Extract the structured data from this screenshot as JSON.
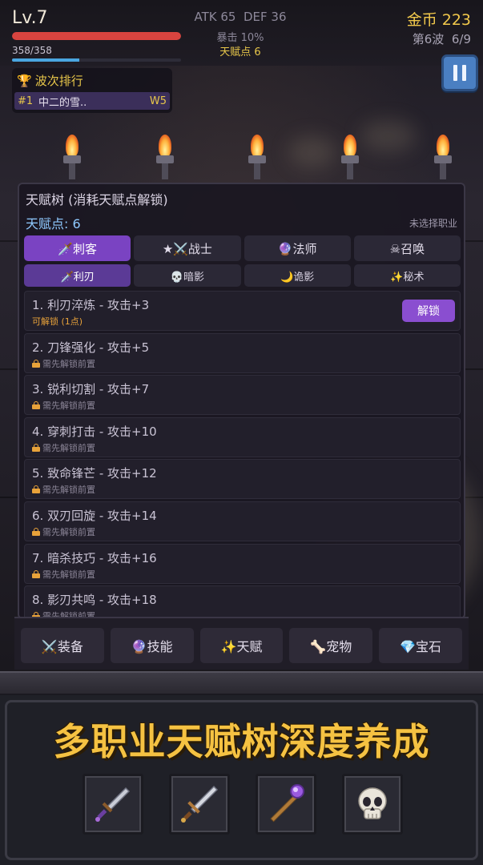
{
  "hud": {
    "level": "Lv.7",
    "hp_text": "358/358",
    "hp_fraction": 1.0,
    "xp_fraction": 0.4,
    "stats": "ATK 65  DEF 36",
    "crit": "暴击 10%",
    "talent_points": "天赋点 6",
    "gold": "金币 223",
    "wave": "第6波  6/9"
  },
  "ranking": {
    "title": "波次排行",
    "rows": [
      {
        "pos": "#1",
        "name": "中二的雪..",
        "wave": "W5"
      }
    ]
  },
  "panel": {
    "title": "天赋树 (消耗天赋点解锁)",
    "points": "天赋点: 6",
    "class_status": "未选择职业",
    "class_tabs": [
      {
        "label": "🗡️刺客"
      },
      {
        "label": "★⚔️战士"
      },
      {
        "label": "🔮法师"
      },
      {
        "label": "☠召唤"
      }
    ],
    "sub_tabs": [
      {
        "label": "🗡️利刃"
      },
      {
        "label": "💀暗影"
      },
      {
        "label": "🌙诡影"
      },
      {
        "label": "✨秘术"
      }
    ],
    "skills": [
      {
        "name": "1. 利刃淬炼 - 攻击+3",
        "status": "可解锁 (1点)"
      },
      {
        "name": "2. 刀锋强化 - 攻击+5",
        "status": "需先解锁前置"
      },
      {
        "name": "3. 锐利切割 - 攻击+7",
        "status": "需先解锁前置"
      },
      {
        "name": "4. 穿刺打击 - 攻击+10",
        "status": "需先解锁前置"
      },
      {
        "name": "5. 致命锋芒 - 攻击+12",
        "status": "需先解锁前置"
      },
      {
        "name": "6. 双刃回旋 - 攻击+14",
        "status": "需先解锁前置"
      },
      {
        "name": "7. 暗杀技巧 - 攻击+16",
        "status": "需先解锁前置"
      },
      {
        "name": "8. 影刃共鸣 - 攻击+18",
        "status": "需先解锁前置"
      }
    ],
    "unlock_label": "解锁"
  },
  "nav": {
    "items": [
      {
        "label": "⚔️装备"
      },
      {
        "label": "🔮技能"
      },
      {
        "label": "✨天赋"
      },
      {
        "label": "🦴宠物"
      },
      {
        "label": "💎宝石"
      }
    ]
  },
  "promo": {
    "title": "多职业天赋树深度养成",
    "slots": [
      "dagger-icon",
      "sword-icon",
      "staff-icon",
      "skull-icon"
    ]
  },
  "colors": {
    "accent_purple": "#7a43c2",
    "gold": "#f2c94c",
    "hp_red": "#d8443f",
    "xp_blue": "#4aa6e0"
  }
}
